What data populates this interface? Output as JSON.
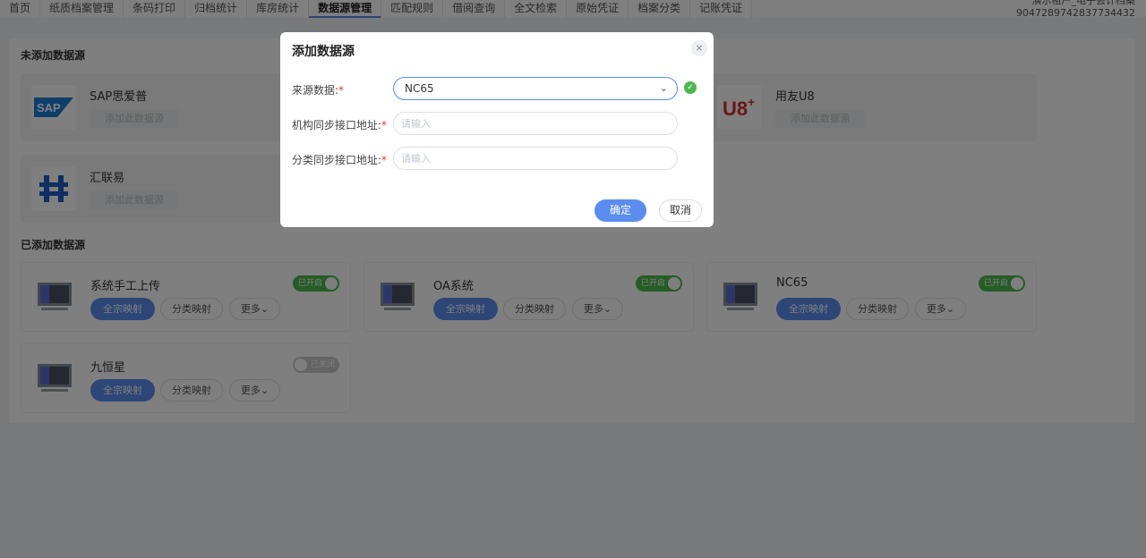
{
  "nav": {
    "items": [
      "首页",
      "纸质档案管理",
      "条码打印",
      "归档统计",
      "库房统计",
      "数据源管理",
      "匹配规则",
      "借阅查询",
      "全文检索",
      "原始凭证",
      "档案分类",
      "记账凭证"
    ],
    "active_index": 5,
    "user_line1": "演示租户_电子会计档案",
    "user_line2": "9047289742837734432"
  },
  "unadded": {
    "title": "未添加数据源",
    "add_label": "添加此数据源",
    "items": [
      {
        "name": "SAP思爱普",
        "logo": "sap-logo"
      },
      {
        "name": "用友U8",
        "logo": "u8-logo"
      },
      {
        "name": "汇联易",
        "logo": "huilianyi-logo"
      }
    ]
  },
  "added": {
    "title": "已添加数据源",
    "primary_label": "全宗映射",
    "mapping_label": "分类映射",
    "more_label": "更多",
    "items": [
      {
        "name": "系统手工上传",
        "toggle": "已开启",
        "enabled": true
      },
      {
        "name": "OA系统",
        "toggle": "已开启",
        "enabled": true
      },
      {
        "name": "NC65",
        "toggle": "已开启",
        "enabled": true
      },
      {
        "name": "九恒星",
        "toggle": "已关闭",
        "enabled": false
      }
    ]
  },
  "dialog": {
    "title": "添加数据源",
    "close_icon": "×",
    "source_label": "来源数据:",
    "source_value": "NC65",
    "org_label": "机构同步接口地址:",
    "org_placeholder": "请输入",
    "cat_label": "分类同步接口地址:",
    "cat_placeholder": "请输入",
    "required_mark": "*",
    "ok_label": "确定",
    "cancel_label": "取消"
  },
  "colors": {
    "accent": "#5b8def",
    "success": "#4cb84c",
    "required": "#e53935"
  }
}
